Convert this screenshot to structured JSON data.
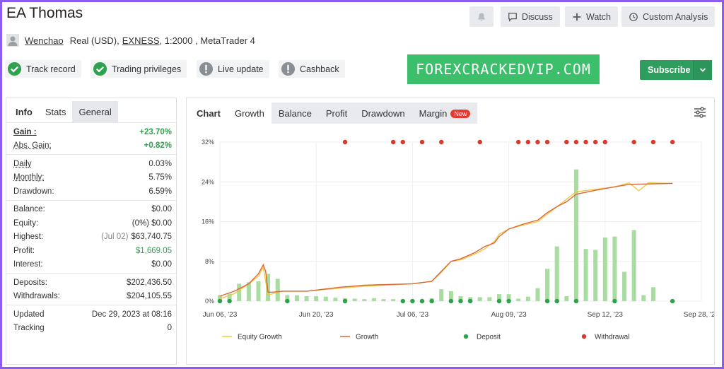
{
  "header": {
    "title": "EA Thomas"
  },
  "top_buttons": {
    "discuss": "Discuss",
    "watch": "Watch",
    "custom": "Custom Analysis"
  },
  "account": {
    "user": "Wenchao",
    "mode": "Real (USD),",
    "broker": "EXNESS",
    "rest": ", 1:2000 , MetaTrader 4"
  },
  "badges": {
    "track": "Track record",
    "privileges": "Trading privileges",
    "live": "Live update",
    "cashback": "Cashback"
  },
  "promo": "FOREXCRACKEDVIP.COM",
  "subscribe": "Subscribe",
  "left_tabs": {
    "info": "Info",
    "stats": "Stats",
    "general": "General"
  },
  "stats": {
    "gain": {
      "k": "Gain :",
      "v": "+23.70%"
    },
    "abs_gain": {
      "k": "Abs. Gain:",
      "v": "+0.82%"
    },
    "daily": {
      "k": "Daily",
      "v": "0.03%"
    },
    "monthly": {
      "k": "Monthly:",
      "v": "5.75%"
    },
    "drawdown": {
      "k": "Drawdown:",
      "v": "6.59%"
    },
    "balance": {
      "k": "Balance:",
      "v": "$0.00"
    },
    "equity": {
      "k": "Equity:",
      "pre": "(0%)",
      "v": "$0.00"
    },
    "highest": {
      "k": "Highest:",
      "pre": "(Jul 02)",
      "v": "$63,740.75"
    },
    "profit": {
      "k": "Profit:",
      "v": "$1,669.05"
    },
    "interest": {
      "k": "Interest:",
      "v": "$0.00"
    },
    "deposits": {
      "k": "Deposits:",
      "v": "$202,436.50"
    },
    "withdrawals": {
      "k": "Withdrawals:",
      "v": "$204,105.55"
    },
    "updated": {
      "k": "Updated",
      "v": "Dec 29, 2023 at 08:16"
    },
    "tracking": {
      "k": "Tracking",
      "v": "0"
    }
  },
  "chart_tabs": {
    "chart": "Chart",
    "growth": "Growth",
    "balance": "Balance",
    "profit": "Profit",
    "drawdown": "Drawdown",
    "margin": "Margin",
    "new": "New"
  },
  "colors": {
    "equity": "#f2c744",
    "growth": "#d9683c",
    "bars": "#a8dca0",
    "deposit": "#2ea24d",
    "withdrawal": "#d93a2b"
  },
  "chart_data": {
    "type": "line",
    "y_ticks": [
      "0%",
      "8%",
      "16%",
      "24%",
      "32%"
    ],
    "ylim": [
      0,
      32
    ],
    "x_ticks": [
      "Jun 06, '23",
      "Jun 20, '23",
      "Jul 06, '23",
      "Aug 09, '23",
      "Sep 12, '23",
      "Sep 28, '23"
    ],
    "legend": [
      "Equity Growth",
      "Growth",
      "Deposit",
      "Withdrawal"
    ],
    "growth_series": [
      [
        0,
        1.0
      ],
      [
        3,
        2.0
      ],
      [
        6,
        3.5
      ],
      [
        8,
        5.5
      ],
      [
        9,
        7.3
      ],
      [
        9.5,
        6.0
      ],
      [
        10,
        1.8
      ],
      [
        11,
        1.8
      ],
      [
        13,
        2.0
      ],
      [
        18,
        2.0
      ],
      [
        25,
        2.8
      ],
      [
        30,
        3.2
      ],
      [
        40,
        3.5
      ],
      [
        44,
        4.0
      ],
      [
        46,
        6.0
      ],
      [
        48,
        8.0
      ],
      [
        50,
        8.5
      ],
      [
        53,
        9.8
      ],
      [
        55,
        11.0
      ],
      [
        57,
        11.7
      ],
      [
        58,
        13.0
      ],
      [
        60,
        14.5
      ],
      [
        63,
        15.5
      ],
      [
        66,
        16.3
      ],
      [
        68,
        17.8
      ],
      [
        70,
        19.0
      ],
      [
        72,
        20.0
      ],
      [
        74,
        21.5
      ],
      [
        78,
        22.3
      ],
      [
        82,
        23.0
      ],
      [
        85,
        23.5
      ],
      [
        90,
        23.6
      ],
      [
        94,
        23.7
      ]
    ],
    "equity_series": [
      [
        0,
        0.5
      ],
      [
        3,
        1.5
      ],
      [
        6,
        3.5
      ],
      [
        8,
        5.0
      ],
      [
        9,
        6.8
      ],
      [
        9.5,
        4.0
      ],
      [
        10,
        1.2
      ],
      [
        11,
        1.5
      ],
      [
        13,
        2.0
      ],
      [
        18,
        2.0
      ],
      [
        25,
        2.6
      ],
      [
        30,
        3.0
      ],
      [
        40,
        3.5
      ],
      [
        44,
        4.0
      ],
      [
        46,
        5.8
      ],
      [
        48,
        8.0
      ],
      [
        50,
        8.3
      ],
      [
        53,
        9.5
      ],
      [
        55,
        10.5
      ],
      [
        56,
        11.3
      ],
      [
        57,
        12.0
      ],
      [
        58,
        13.5
      ],
      [
        60,
        14.5
      ],
      [
        63,
        15.3
      ],
      [
        66,
        16.0
      ],
      [
        68,
        17.5
      ],
      [
        70,
        19.0
      ],
      [
        72,
        20.5
      ],
      [
        74,
        22.0
      ],
      [
        78,
        22.5
      ],
      [
        82,
        23.0
      ],
      [
        85,
        23.8
      ],
      [
        87,
        22.2
      ],
      [
        89,
        23.8
      ],
      [
        94,
        23.7
      ]
    ],
    "bars": [
      [
        0,
        1.2
      ],
      [
        2,
        1.5
      ],
      [
        4,
        3.5
      ],
      [
        6,
        3.8
      ],
      [
        8,
        4.0
      ],
      [
        10,
        5.5
      ],
      [
        12,
        4.5
      ],
      [
        14,
        1.2
      ],
      [
        16,
        1.2
      ],
      [
        18,
        1.0
      ],
      [
        20,
        1.0
      ],
      [
        22,
        0.9
      ],
      [
        24,
        0.7
      ],
      [
        26,
        0.6
      ],
      [
        28,
        0.5
      ],
      [
        30,
        0.4
      ],
      [
        32,
        0.6
      ],
      [
        34,
        0.4
      ],
      [
        36,
        0.4
      ],
      [
        38,
        0.3
      ],
      [
        40,
        0.3
      ],
      [
        42,
        0.3
      ],
      [
        44,
        0.6
      ],
      [
        46,
        2.4
      ],
      [
        48,
        2.0
      ],
      [
        50,
        1.0
      ],
      [
        52,
        0.8
      ],
      [
        54,
        0.8
      ],
      [
        56,
        0.8
      ],
      [
        58,
        1.4
      ],
      [
        60,
        1.4
      ],
      [
        62,
        0.5
      ],
      [
        64,
        0.9
      ],
      [
        66,
        2.6
      ],
      [
        68,
        6.5
      ],
      [
        70,
        11.0
      ],
      [
        72,
        1.0
      ],
      [
        74,
        26.5
      ],
      [
        76,
        10.5
      ],
      [
        78,
        10.3
      ],
      [
        80,
        12.8
      ],
      [
        82,
        13.0
      ],
      [
        84,
        5.9
      ],
      [
        86,
        14.3
      ],
      [
        88,
        1.2
      ],
      [
        90,
        2.8
      ]
    ],
    "deposits_x": [
      0,
      2,
      14,
      26,
      38,
      40,
      42,
      44,
      48,
      50,
      52,
      58,
      60,
      68,
      70,
      74,
      82,
      94
    ],
    "withdrawals_x": [
      26,
      36,
      38,
      42,
      46,
      54,
      62,
      64,
      66,
      68,
      72,
      74,
      76,
      78,
      80,
      86,
      90,
      94
    ]
  }
}
